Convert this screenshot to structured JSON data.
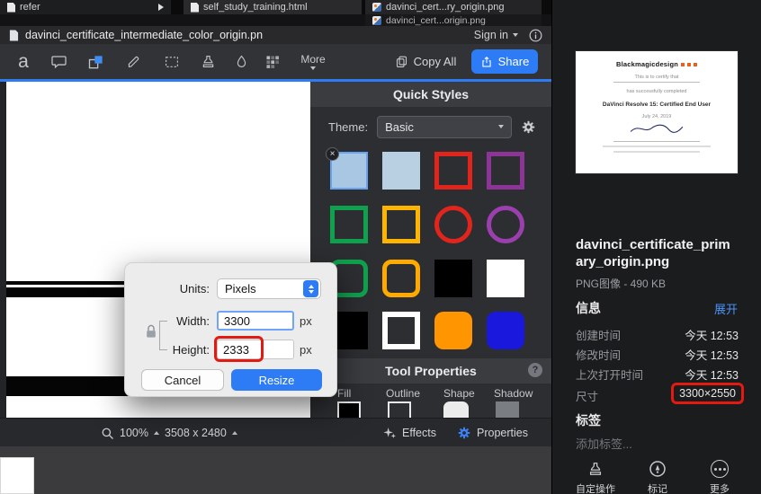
{
  "colors": {
    "accent": "#2e7bf6",
    "annotation_red": "#e21a12"
  },
  "tabs": {
    "refer": {
      "label": "refer"
    },
    "row1": [
      {
        "label": "self_study_training.html"
      },
      {
        "label": "davinci_cert...ry_origin.png"
      }
    ],
    "row2": {
      "label": "davinci_cert...origin.png"
    }
  },
  "titlebar": {
    "title": "davinci_certificate_intermediate_color_origin.pn",
    "sign_in": "Sign in"
  },
  "toolbar": {
    "more": "More",
    "copy_all": "Copy All",
    "share": "Share"
  },
  "quick_styles": {
    "title": "Quick Styles",
    "theme_label": "Theme:",
    "theme_value": "Basic",
    "swatches": [
      {
        "kind": "square-fill-selected",
        "color": "#a9c6e2"
      },
      {
        "kind": "square-fill",
        "color": "#b9cfe2"
      },
      {
        "kind": "square-outline",
        "color": "#e2251c"
      },
      {
        "kind": "square-outline",
        "color": "#8c3596"
      },
      {
        "kind": "square-outline",
        "color": "#0fa14e"
      },
      {
        "kind": "square-outline",
        "color": "#ffb400"
      },
      {
        "kind": "circle-outline",
        "color": "#e2251c"
      },
      {
        "kind": "circle-outline",
        "color": "#9b3fae"
      },
      {
        "kind": "rounded-outline",
        "color": "#0fa14e"
      },
      {
        "kind": "rounded-outline",
        "color": "#ffaa00"
      },
      {
        "kind": "square-fill",
        "color": "#000000"
      },
      {
        "kind": "square-fill",
        "color": "#ffffff"
      },
      {
        "kind": "square-fill",
        "color": "#000000"
      },
      {
        "kind": "square-outline-thick",
        "color": "#ffffff"
      },
      {
        "kind": "rounded-fill",
        "color": "#ff9500"
      },
      {
        "kind": "rounded-fill",
        "color": "#1a18dd"
      }
    ]
  },
  "tool_properties": {
    "title": "Tool Properties",
    "help": "?",
    "fields": [
      "Fill",
      "Outline",
      "Shape",
      "Shadow"
    ]
  },
  "dialog": {
    "units_label": "Units:",
    "units_value": "Pixels",
    "width_label": "Width:",
    "width_value": "3300",
    "height_label": "Height:",
    "height_value": "2333",
    "unit": "px",
    "cancel": "Cancel",
    "resize": "Resize"
  },
  "statusbar": {
    "zoom": "100%",
    "canvas_size": "3508 x 2480",
    "effects": "Effects",
    "properties": "Properties"
  },
  "preview": {
    "filename": "davinci_certificate_primary_origin.png",
    "meta": "PNG图像 - 490 KB",
    "info_title": "信息",
    "expand": "展开",
    "rows": [
      {
        "label": "创建时间",
        "value": "今天 12:53"
      },
      {
        "label": "修改时间",
        "value": "今天 12:53"
      },
      {
        "label": "上次打开时间",
        "value": "今天 12:53"
      },
      {
        "label": "尺寸",
        "value": "3300×2550"
      }
    ],
    "tags_title": "标签",
    "add_tags": "添加标签...",
    "actions": [
      {
        "label": "自定操作"
      },
      {
        "label": "标记"
      },
      {
        "label": "更多"
      }
    ]
  },
  "certificate": {
    "brand": "Blackmagicdesign",
    "line1": "This is to certify that",
    "line2": "has successfully completed",
    "course": "DaVinci Resolve 15: Certified End User",
    "date": "July 24, 2019"
  }
}
